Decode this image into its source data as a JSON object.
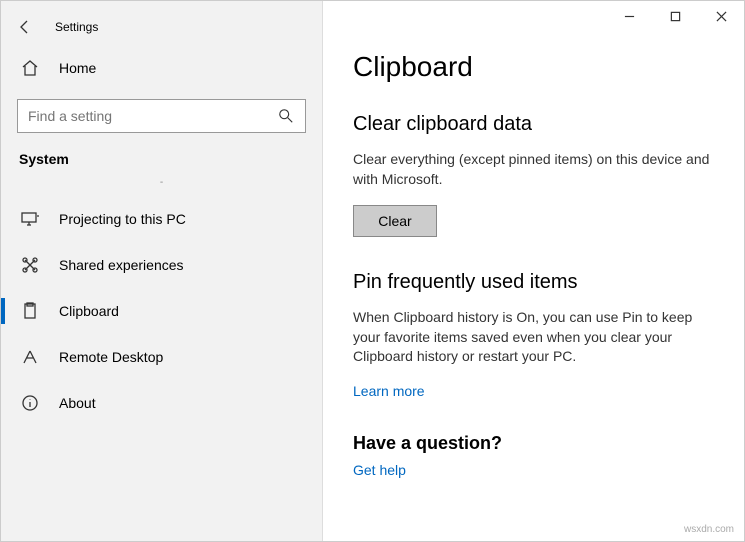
{
  "window": {
    "title": "Settings"
  },
  "sidebar": {
    "home": "Home",
    "search_placeholder": "Find a setting",
    "category": "System",
    "items": [
      {
        "label": "Projecting to this PC"
      },
      {
        "label": "Shared experiences"
      },
      {
        "label": "Clipboard"
      },
      {
        "label": "Remote Desktop"
      },
      {
        "label": "About"
      }
    ]
  },
  "main": {
    "heading": "Clipboard",
    "section1": {
      "title": "Clear clipboard data",
      "body": "Clear everything (except pinned items) on this device and with Microsoft.",
      "button": "Clear"
    },
    "section2": {
      "title": "Pin frequently used items",
      "body": "When Clipboard history is On, you can use Pin to keep your favorite items saved even when you clear your Clipboard history or restart your PC.",
      "link": "Learn more"
    },
    "section3": {
      "title": "Have a question?",
      "link": "Get help"
    }
  },
  "watermark": "wsxdn.com"
}
